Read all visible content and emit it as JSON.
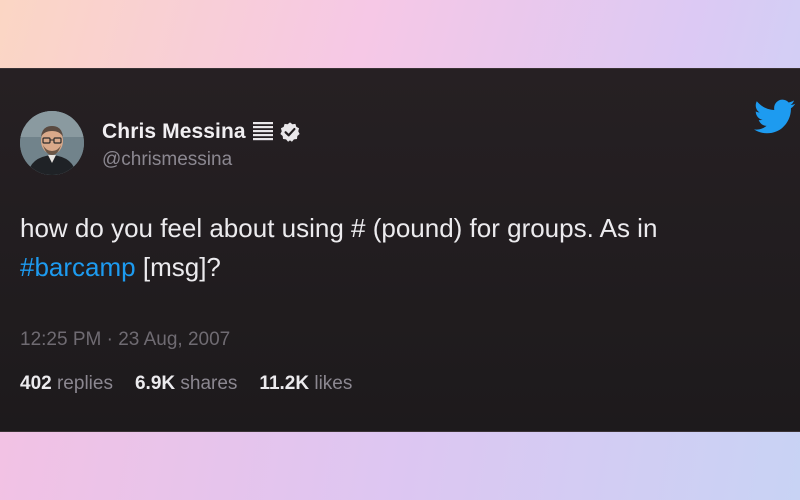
{
  "author": {
    "display_name": "Chris Messina",
    "handle": "@chrismessina",
    "verified": true
  },
  "tweet": {
    "text_before": "how do you feel about using # (pound) for groups. As in ",
    "hashtag": "#barcamp",
    "text_after": " [msg]?",
    "timestamp": "12:25 PM · 23 Aug, 2007"
  },
  "stats": {
    "replies_count": "402",
    "replies_label": "replies",
    "shares_count": "6.9K",
    "shares_label": "shares",
    "likes_count": "11.2K",
    "likes_label": "likes"
  },
  "icons": {
    "brand": "twitter-bird-icon",
    "verified": "verified-badge-icon",
    "extra": "bars-icon"
  },
  "colors": {
    "hashtag": "#1d9bf0",
    "twitter_brand": "#1d9bf0",
    "card_background": "#221e20"
  }
}
